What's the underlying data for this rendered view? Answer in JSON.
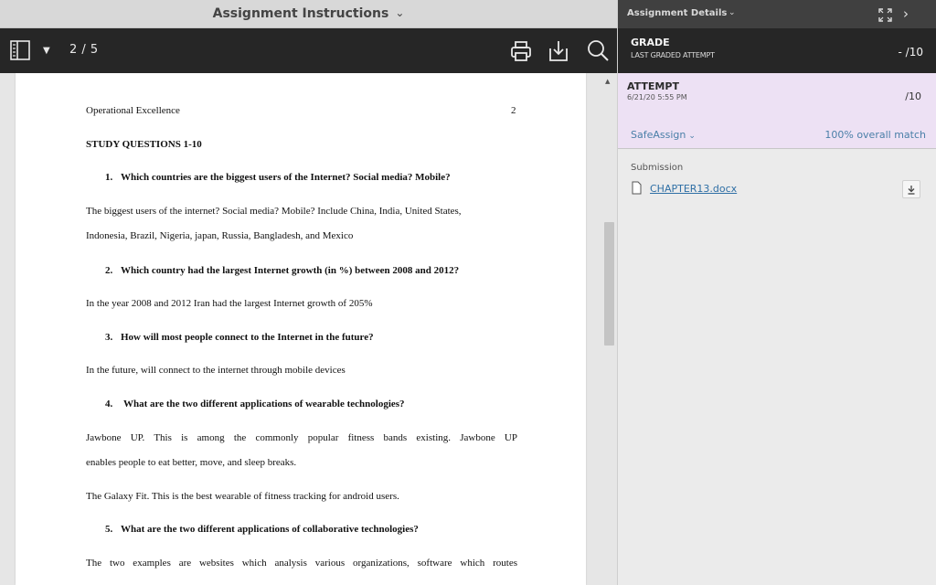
{
  "instructions_header": {
    "title": "Assignment Instructions",
    "chevron_icon": "chevron-down-icon"
  },
  "toolbar": {
    "sidebar_icon": "sidebar-toggle-icon",
    "page_menu_icon": "caret-down-icon",
    "page_indicator": "2 / 5",
    "print_icon": "print-icon",
    "download_icon": "download-icon",
    "search_icon": "search-icon"
  },
  "document": {
    "running_head": "Operational Excellence",
    "page_number": "2",
    "heading": "STUDY QUESTIONS 1-10",
    "q1": {
      "num": "1.",
      "text": "Which countries are the biggest users of the Internet? Social media? Mobile?"
    },
    "a1_line1": "The biggest users of the internet? Social media? Mobile? Include China, India, United States,",
    "a1_line2": "Indonesia, Brazil, Nigeria, japan, Russia, Bangladesh, and Mexico",
    "q2": {
      "num": "2.",
      "text": "Which country had the largest Internet growth (in %) between 2008 and 2012?"
    },
    "a2": "In the year 2008 and 2012 Iran had the largest Internet growth of 205%",
    "q3": {
      "num": "3.",
      "text": "How will most people connect to the Internet in the future?"
    },
    "a3": "In the future, will connect to the internet through mobile devices",
    "q4": {
      "num": "4.",
      "text": "What are the two different applications of wearable technologies?"
    },
    "a4_line1": "Jawbone UP. This is among the commonly popular fitness bands existing. Jawbone UP",
    "a4_line2": "enables people to eat better, move, and sleep breaks.",
    "a4_line3": "The Galaxy Fit. This is the best wearable of fitness tracking for android users.",
    "q5": {
      "num": "5.",
      "text": "What are the two different applications of collaborative technologies?"
    },
    "a5_line1": "The two examples are websites which analysis various organizations, software which routes"
  },
  "details_header": {
    "title": "Assignment Details",
    "chevron_icon": "chevron-down-icon",
    "expand_icon": "expand-icon",
    "collapse_icon": "chevron-right-icon"
  },
  "grade": {
    "label": "GRADE",
    "sublabel": "LAST GRADED ATTEMPT",
    "value": "- /10"
  },
  "attempt": {
    "label": "ATTEMPT",
    "date": "6/21/20 5:55 PM",
    "value": "/10"
  },
  "safeassign": {
    "label": "SafeAssign",
    "chevron_icon": "chevron-down-icon",
    "match": "100% overall match"
  },
  "submission": {
    "label": "Submission",
    "file_icon": "file-icon",
    "file_name": "CHAPTER13.docx",
    "download_icon": "download-icon"
  },
  "colors": {
    "toolbar_bg": "#262626",
    "attempt_bg": "#ede1f4",
    "link": "#2f6fa5",
    "accent_link": "#4a7fa8"
  }
}
